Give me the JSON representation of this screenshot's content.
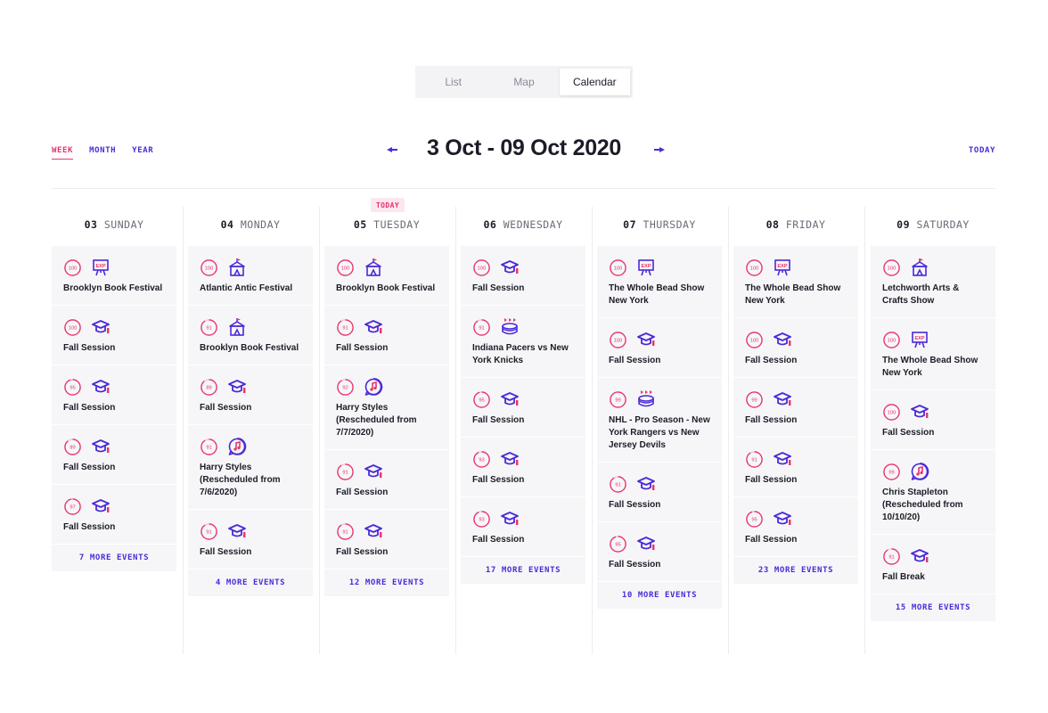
{
  "view_tabs": [
    "List",
    "Map",
    "Calendar"
  ],
  "active_view": "Calendar",
  "range_links": [
    {
      "label": "WEEK",
      "active": true
    },
    {
      "label": "MONTH",
      "active": false
    },
    {
      "label": "YEAR",
      "active": false
    }
  ],
  "title": "3 Oct - 09 Oct 2020",
  "today_label": "TODAY",
  "today_badge": "TODAY",
  "colors": {
    "accent_pink": "#e8336d",
    "accent_purple": "#4b2ad7",
    "card_bg": "#f6f6f8"
  },
  "days": [
    {
      "num": "03",
      "name": "SUNDAY",
      "is_today": false,
      "events": [
        {
          "score": "100",
          "score_pct": 1.0,
          "icon": "expo-icon",
          "title": "Brooklyn Book Festival"
        },
        {
          "score": "100",
          "score_pct": 1.0,
          "icon": "graduation-cap-icon",
          "title": "Fall Session"
        },
        {
          "score": "95",
          "score_pct": 0.95,
          "icon": "graduation-cap-icon",
          "title": "Fall Session"
        },
        {
          "score": "89",
          "score_pct": 0.89,
          "icon": "graduation-cap-icon",
          "title": "Fall Session"
        },
        {
          "score": "97",
          "score_pct": 0.97,
          "icon": "graduation-cap-icon",
          "title": "Fall Session"
        }
      ],
      "more": "7 MORE EVENTS"
    },
    {
      "num": "04",
      "name": "MONDAY",
      "is_today": false,
      "events": [
        {
          "score": "100",
          "score_pct": 1.0,
          "icon": "festival-tent-icon",
          "title": "Atlantic Antic Festival"
        },
        {
          "score": "91",
          "score_pct": 0.91,
          "icon": "festival-tent-icon",
          "title": "Brooklyn Book Festival"
        },
        {
          "score": "89",
          "score_pct": 0.89,
          "icon": "graduation-cap-icon",
          "title": "Fall Session"
        },
        {
          "score": "91",
          "score_pct": 0.91,
          "icon": "concert-icon",
          "title": "Harry Styles (Rescheduled from 7/6/2020)"
        },
        {
          "score": "91",
          "score_pct": 0.91,
          "icon": "graduation-cap-icon",
          "title": "Fall Session"
        }
      ],
      "more": "4 MORE EVENTS"
    },
    {
      "num": "05",
      "name": "TUESDAY",
      "is_today": true,
      "events": [
        {
          "score": "100",
          "score_pct": 1.0,
          "icon": "festival-tent-icon",
          "title": "Brooklyn Book Festival"
        },
        {
          "score": "91",
          "score_pct": 0.91,
          "icon": "graduation-cap-icon",
          "title": "Fall Session"
        },
        {
          "score": "92",
          "score_pct": 0.92,
          "icon": "concert-icon",
          "title": "Harry Styles (Rescheduled from 7/7/2020)"
        },
        {
          "score": "91",
          "score_pct": 0.91,
          "icon": "graduation-cap-icon",
          "title": "Fall Session"
        },
        {
          "score": "91",
          "score_pct": 0.91,
          "icon": "graduation-cap-icon",
          "title": "Fall Session"
        }
      ],
      "more": "12 MORE EVENTS"
    },
    {
      "num": "06",
      "name": "WEDNESDAY",
      "is_today": false,
      "events": [
        {
          "score": "100",
          "score_pct": 1.0,
          "icon": "graduation-cap-icon",
          "title": "Fall Session"
        },
        {
          "score": "91",
          "score_pct": 0.91,
          "icon": "sports-drum-icon",
          "title": "Indiana Pacers vs New York Knicks"
        },
        {
          "score": "95",
          "score_pct": 0.95,
          "icon": "graduation-cap-icon",
          "title": "Fall Session"
        },
        {
          "score": "93",
          "score_pct": 0.93,
          "icon": "graduation-cap-icon",
          "title": "Fall Session"
        },
        {
          "score": "93",
          "score_pct": 0.93,
          "icon": "graduation-cap-icon",
          "title": "Fall Session"
        }
      ],
      "more": "17 MORE EVENTS"
    },
    {
      "num": "07",
      "name": "THURSDAY",
      "is_today": false,
      "events": [
        {
          "score": "100",
          "score_pct": 1.0,
          "icon": "expo-icon",
          "title": "The Whole Bead Show New York"
        },
        {
          "score": "100",
          "score_pct": 1.0,
          "icon": "graduation-cap-icon",
          "title": "Fall Session"
        },
        {
          "score": "99",
          "score_pct": 0.99,
          "icon": "sports-drum-icon",
          "title": "NHL - Pro Season - New York Rangers vs New Jersey Devils"
        },
        {
          "score": "91",
          "score_pct": 0.91,
          "icon": "graduation-cap-icon",
          "title": "Fall Session"
        },
        {
          "score": "95",
          "score_pct": 0.95,
          "icon": "graduation-cap-icon",
          "title": "Fall Session"
        }
      ],
      "more": "10 MORE EVENTS"
    },
    {
      "num": "08",
      "name": "FRIDAY",
      "is_today": false,
      "events": [
        {
          "score": "100",
          "score_pct": 1.0,
          "icon": "expo-icon",
          "title": "The Whole Bead Show New York"
        },
        {
          "score": "100",
          "score_pct": 1.0,
          "icon": "graduation-cap-icon",
          "title": "Fall Session"
        },
        {
          "score": "99",
          "score_pct": 0.99,
          "icon": "graduation-cap-icon",
          "title": "Fall Session"
        },
        {
          "score": "91",
          "score_pct": 0.91,
          "icon": "graduation-cap-icon",
          "title": "Fall Session"
        },
        {
          "score": "95",
          "score_pct": 0.95,
          "icon": "graduation-cap-icon",
          "title": "Fall Session"
        }
      ],
      "more": "23 MORE EVENTS"
    },
    {
      "num": "09",
      "name": "SATURDAY",
      "is_today": false,
      "events": [
        {
          "score": "100",
          "score_pct": 1.0,
          "icon": "festival-tent-icon",
          "title": "Letchworth Arts & Crafts Show"
        },
        {
          "score": "100",
          "score_pct": 1.0,
          "icon": "expo-icon",
          "title": "The Whole Bead Show New York"
        },
        {
          "score": "100",
          "score_pct": 1.0,
          "icon": "graduation-cap-icon",
          "title": "Fall Session"
        },
        {
          "score": "99",
          "score_pct": 0.99,
          "icon": "concert-icon",
          "title": "Chris Stapleton (Rescheduled from 10/10/20)"
        },
        {
          "score": "91",
          "score_pct": 0.91,
          "icon": "graduation-cap-icon",
          "title": "Fall Break"
        }
      ],
      "more": "15 MORE EVENTS"
    }
  ]
}
